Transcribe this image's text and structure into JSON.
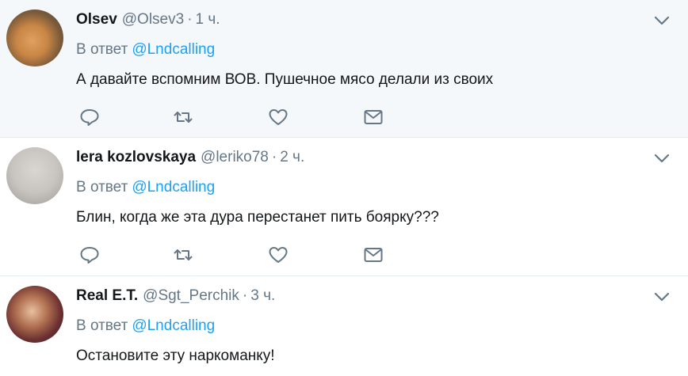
{
  "tweets": [
    {
      "name": "Olsev",
      "handle": "@Olsev3",
      "dot": "·",
      "time": "1 ч.",
      "reply_prefix": "В ответ",
      "reply_to": "@Lndcalling",
      "text": "А давайте вспомним ВОВ. Пушечное мясо делали из своих",
      "avatar_icon": "cat-avatar"
    },
    {
      "name": "lera kozlovskaya",
      "handle": "@leriko78",
      "dot": "·",
      "time": "2 ч.",
      "reply_prefix": "В ответ",
      "reply_to": "@Lndcalling",
      "text": "Блин, когда же эта дура перестанет пить боярку???",
      "avatar_icon": "woman-avatar"
    },
    {
      "name": "Real E.T.",
      "handle": "@Sgt_Perchik",
      "dot": "·",
      "time": "3 ч.",
      "reply_prefix": "В ответ",
      "reply_to": "@Lndcalling",
      "text": "Остановите эту наркоманку!",
      "avatar_icon": "man-avatar"
    }
  ],
  "colors": {
    "accent": "#1da1f2",
    "muted": "#657786",
    "text": "#14171a",
    "highlight_bg": "#f5f8fa",
    "divider": "#e6ecf0"
  },
  "icons": [
    "reply-icon",
    "retweet-icon",
    "like-icon",
    "direct-message-icon",
    "chevron-down-icon"
  ]
}
